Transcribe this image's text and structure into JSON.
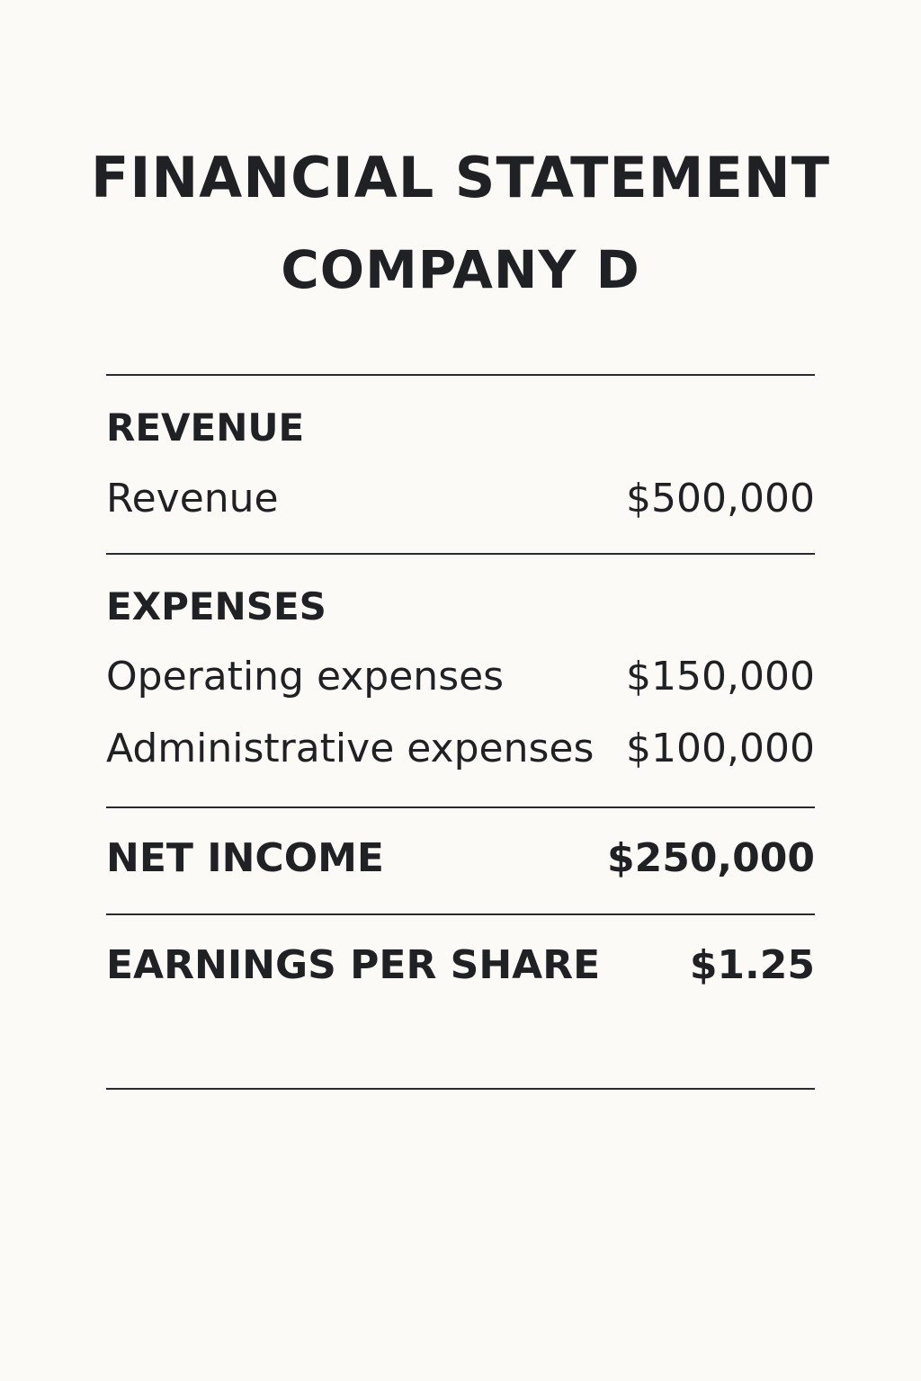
{
  "header": {
    "title": "FINANCIAL STATEMENT",
    "subtitle": "COMPANY D"
  },
  "revenue": {
    "heading": "REVENUE",
    "items": [
      {
        "label": "Revenue",
        "amount": "$500,000"
      }
    ]
  },
  "expenses": {
    "heading": "EXPENSES",
    "items": [
      {
        "label": "Operating expenses",
        "amount": "$150,000"
      },
      {
        "label": "Administrative expenses",
        "amount": "$100,000"
      }
    ]
  },
  "net_income": {
    "label": "NET INCOME",
    "amount": "$250,000"
  },
  "eps": {
    "label": "EARNINGS PER SHARE",
    "amount": "$1.25"
  }
}
